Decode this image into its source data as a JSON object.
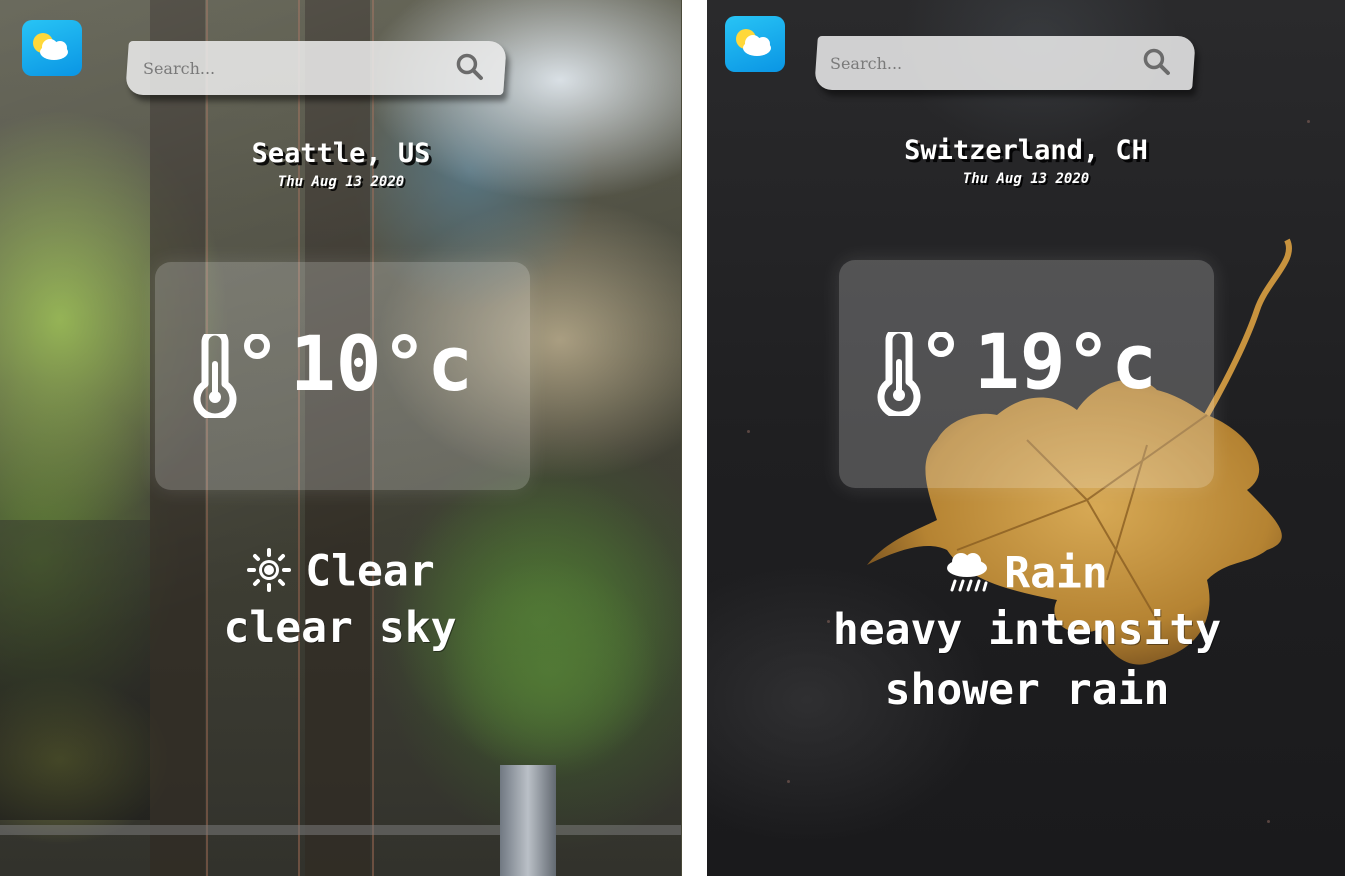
{
  "panels": [
    {
      "id": "seattle",
      "search": {
        "placeholder": "Search..."
      },
      "location": "Seattle, US",
      "date": "Thu Aug 13 2020",
      "temperature": "10°c",
      "condition": {
        "icon": "sun-icon",
        "main": "Clear",
        "description": "clear sky"
      }
    },
    {
      "id": "switzerland",
      "search": {
        "placeholder": "Search..."
      },
      "location": "Switzerland, CH",
      "date": "Thu Aug 13 2020",
      "temperature": "19°c",
      "condition": {
        "icon": "rain-cloud-icon",
        "main": "Rain",
        "description": "heavy intensity shower rain"
      }
    }
  ],
  "colors": {
    "logo_top": "#28c4f5",
    "logo_bottom": "#0a95e4",
    "text": "#ffffff"
  }
}
